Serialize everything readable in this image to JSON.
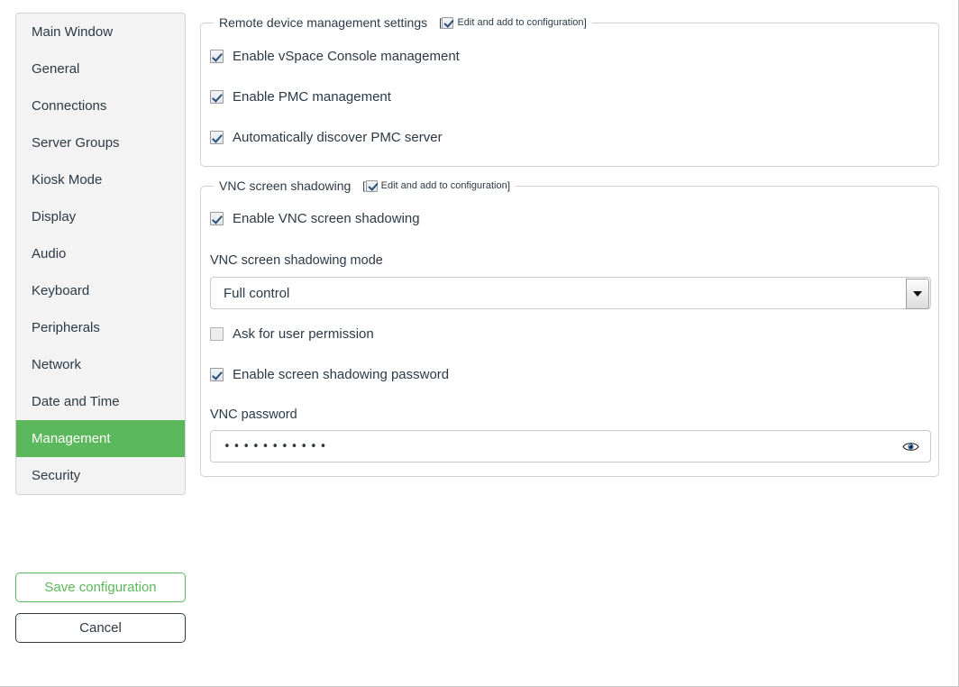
{
  "sidebar": {
    "items": [
      {
        "label": "Main Window",
        "active": false
      },
      {
        "label": "General",
        "active": false
      },
      {
        "label": "Connections",
        "active": false
      },
      {
        "label": "Server Groups",
        "active": false
      },
      {
        "label": "Kiosk Mode",
        "active": false
      },
      {
        "label": "Display",
        "active": false
      },
      {
        "label": "Audio",
        "active": false
      },
      {
        "label": "Keyboard",
        "active": false
      },
      {
        "label": "Peripherals",
        "active": false
      },
      {
        "label": "Network",
        "active": false
      },
      {
        "label": "Date and Time",
        "active": false
      },
      {
        "label": "Management",
        "active": true
      },
      {
        "label": "Security",
        "active": false
      }
    ],
    "active_accent": "#5cb85c"
  },
  "actions": {
    "save_label": "Save configuration",
    "cancel_label": "Cancel",
    "save_color": "#5cb85c",
    "cancel_color": "#2b3a46"
  },
  "remote_section": {
    "legend": "Remote device management settings",
    "edit_bracket_open": "[",
    "edit_label": "Edit and add to configuration",
    "edit_bracket_close": "]",
    "edit_checked": true,
    "options": [
      {
        "label": "Enable vSpace Console management",
        "checked": true
      },
      {
        "label": "Enable PMC management",
        "checked": true
      },
      {
        "label": "Automatically discover PMC server",
        "checked": true
      }
    ]
  },
  "vnc_section": {
    "legend": "VNC screen shadowing",
    "edit_bracket_open": "[",
    "edit_label": "Edit and add to configuration",
    "edit_bracket_close": "]",
    "edit_checked": true,
    "enable_label": "Enable VNC screen shadowing",
    "enable_checked": true,
    "mode_label": "VNC screen shadowing mode",
    "mode_value": "Full control",
    "ask_permission_label": "Ask for user permission",
    "ask_permission_checked": false,
    "enable_password_label": "Enable screen shadowing password",
    "enable_password_checked": true,
    "password_label": "VNC password",
    "password_masked": "•••••••••••",
    "reveal_icon": "eye-icon"
  }
}
